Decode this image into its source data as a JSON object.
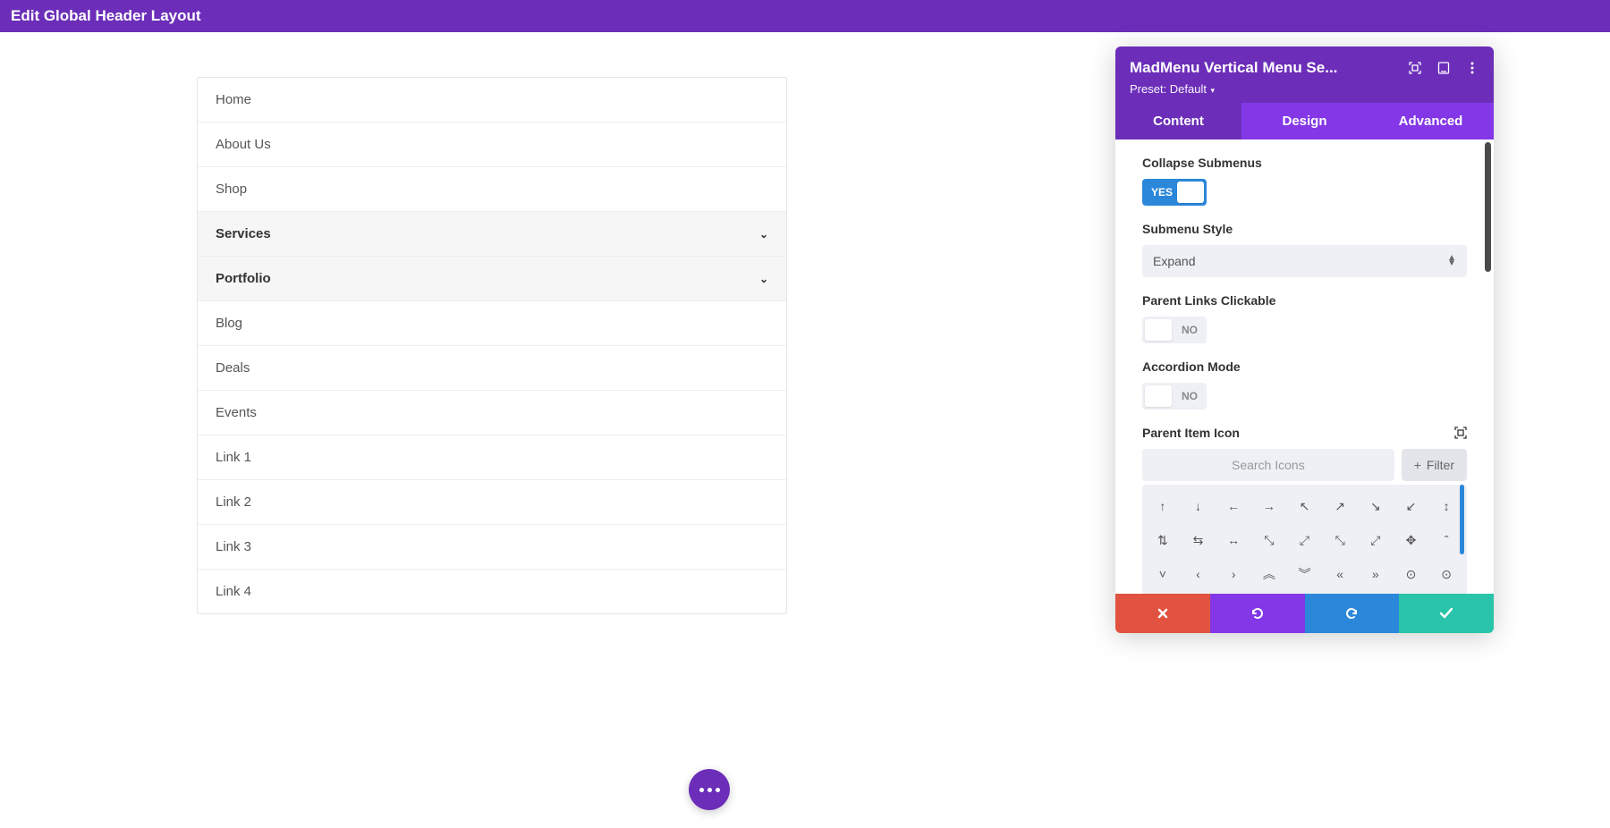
{
  "header": {
    "title": "Edit Global Header Layout"
  },
  "menu": {
    "items": [
      {
        "label": "Home",
        "parent": false
      },
      {
        "label": "About Us",
        "parent": false
      },
      {
        "label": "Shop",
        "parent": false
      },
      {
        "label": "Services",
        "parent": true
      },
      {
        "label": "Portfolio",
        "parent": true
      },
      {
        "label": "Blog",
        "parent": false
      },
      {
        "label": "Deals",
        "parent": false
      },
      {
        "label": "Events",
        "parent": false
      },
      {
        "label": "Link 1",
        "parent": false
      },
      {
        "label": "Link 2",
        "parent": false
      },
      {
        "label": "Link 3",
        "parent": false
      },
      {
        "label": "Link 4",
        "parent": false
      }
    ]
  },
  "panel": {
    "title": "MadMenu Vertical Menu Se...",
    "preset_label": "Preset: Default",
    "tabs": {
      "content": "Content",
      "design": "Design",
      "advanced": "Advanced"
    },
    "controls": {
      "collapse_submenus": {
        "label": "Collapse Submenus",
        "value": "YES"
      },
      "submenu_style": {
        "label": "Submenu Style",
        "value": "Expand"
      },
      "parent_links_clickable": {
        "label": "Parent Links Clickable",
        "value": "NO"
      },
      "accordion_mode": {
        "label": "Accordion Mode",
        "value": "NO"
      },
      "parent_item_icon": {
        "label": "Parent Item Icon",
        "search_placeholder": "Search Icons",
        "filter_label": "Filter"
      }
    },
    "icons": [
      "↑",
      "↓",
      "←",
      "→",
      "↖",
      "↗",
      "↘",
      "↙",
      "↕",
      "⇅",
      "⇆",
      "↔",
      "⤡",
      "⤢",
      "⤡",
      "⤢",
      "✥",
      "ˆ",
      "˅",
      "‹",
      "›",
      "«",
      "»",
      "«",
      "»",
      "⊙",
      "⊙"
    ]
  }
}
